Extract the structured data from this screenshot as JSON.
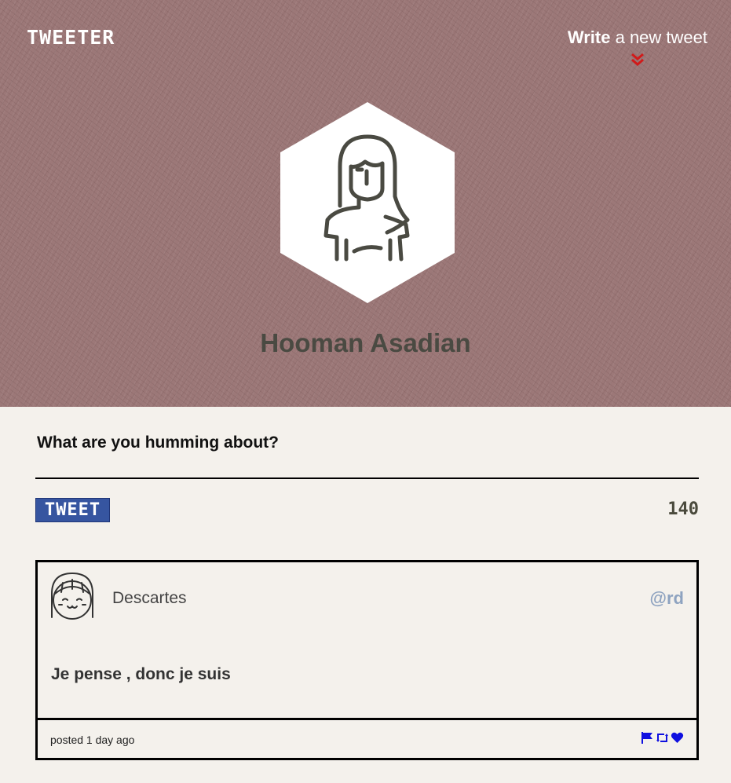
{
  "header": {
    "logo": "TWEETER",
    "write_link": {
      "strong": "Write",
      "rest": " a new tweet"
    },
    "chevron_icon": "double-chevron-down-icon",
    "chevron_color": "#d11a1a"
  },
  "profile": {
    "name": "Hooman Asadian",
    "avatar_icon": "woman-avatar-icon"
  },
  "composer": {
    "placeholder": "What are you humming about?",
    "value": "",
    "button_label": "TWEET",
    "char_count": "140",
    "button_color": "#3655a0"
  },
  "tweets": [
    {
      "author": "Descartes",
      "handle": "@rd",
      "text": "Je pense , donc je suis",
      "posted": "posted 1 day ago",
      "avatar_icon": "girl-avatar-icon",
      "actions": [
        "flag-icon",
        "retweet-icon",
        "heart-icon"
      ],
      "action_color": "#1010e0"
    }
  ],
  "colors": {
    "hero_bg": "#9c7878",
    "page_bg": "#f4f1ec",
    "name_color": "#4a4a42",
    "handle_color": "#8ea3c0"
  }
}
